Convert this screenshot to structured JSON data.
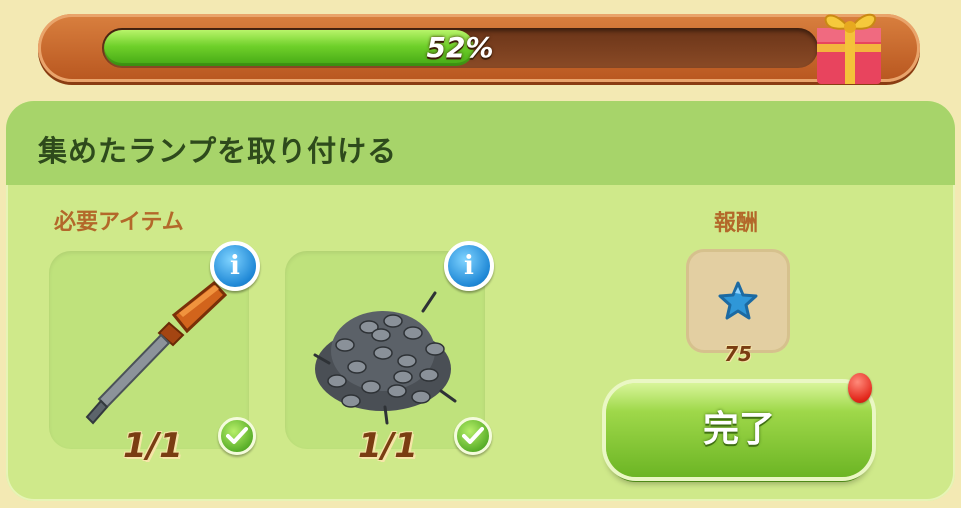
{
  "progress": {
    "percent_text": "52%",
    "fraction": 0.52
  },
  "quest": {
    "title": "集めたランプを取り付ける",
    "required_label": "必要アイテム",
    "reward_label": "報酬",
    "items": [
      {
        "icon": "screwdriver",
        "count": "1/1",
        "info_symbol": "i",
        "completed": true
      },
      {
        "icon": "screws-pile",
        "count": "1/1",
        "info_symbol": "i",
        "completed": true
      }
    ],
    "reward": {
      "icon": "blue-star",
      "amount": "75"
    },
    "complete_button_label": "完了"
  },
  "colors": {
    "progress_fill": "#6fd02a",
    "panel_bg": "#cfe98a",
    "header_bg": "#a7d46a",
    "accent_orange": "#b3682a",
    "button_green": "#9fd84a",
    "notification_red": "#e3281c"
  }
}
